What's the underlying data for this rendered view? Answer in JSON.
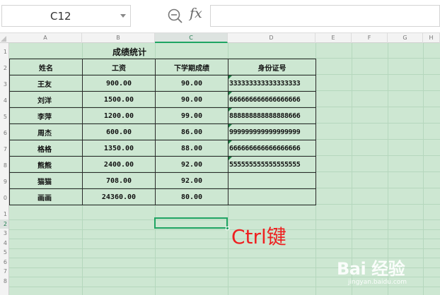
{
  "formula_bar": {
    "cell_ref": "C12",
    "fx_label": "fx",
    "formula": ""
  },
  "columns": [
    "A",
    "B",
    "C",
    "D",
    "E",
    "F",
    "G",
    "H"
  ],
  "selected_column": "C",
  "rows": [
    "1",
    "2",
    "3",
    "4",
    "5",
    "6",
    "7",
    "8",
    "9",
    "0",
    "1",
    "2",
    "3",
    "4",
    "5",
    "6",
    "7",
    "8"
  ],
  "selected_row_index": 11,
  "sheet": {
    "title": "成绩统计",
    "headers": [
      "姓名",
      "工资",
      "下学期成绩",
      "身份证号"
    ],
    "records": [
      [
        "王友",
        "900.00",
        "90.00",
        "333333333333333333"
      ],
      [
        "刘洋",
        "1500.00",
        "90.00",
        "666666666666666666"
      ],
      [
        "李萍",
        "1200.00",
        "99.00",
        "888888888888888666"
      ],
      [
        "周杰",
        "600.00",
        "86.00",
        "999999999999999999"
      ],
      [
        "格格",
        "1350.00",
        "88.00",
        "666666666666666666"
      ],
      [
        "熊熊",
        "2400.00",
        "92.00",
        "555555555555555555"
      ],
      [
        "猫猫",
        "708.00",
        "92.00",
        ""
      ],
      [
        "画画",
        "24360.00",
        "80.00",
        ""
      ]
    ]
  },
  "annotation": "Ctrl键",
  "watermark": {
    "main": "Bai 经验",
    "sub": "jingyan.baidu.com"
  },
  "colors": {
    "sheet_bg": "#cde7d2",
    "selection": "#1fa463",
    "annotation": "#ee2020"
  }
}
